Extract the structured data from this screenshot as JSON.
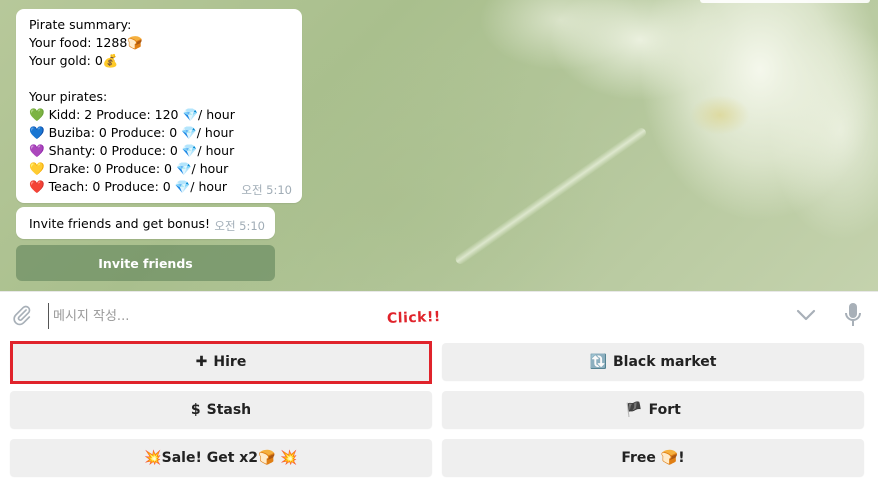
{
  "chat": {
    "summary": {
      "title": "Pirate summary:",
      "food_line": "Your food: 1288🍞",
      "gold_line": "Your gold: 0💰",
      "pirates_heading": "Your pirates:",
      "pirates": [
        {
          "emoji": "💚",
          "text": "Kidd: 2 Produce: 120 💎/ hour"
        },
        {
          "emoji": "💙",
          "text": "Buziba: 0 Produce: 0 💎/ hour"
        },
        {
          "emoji": "💜",
          "text": "Shanty: 0 Produce: 0 💎/ hour"
        },
        {
          "emoji": "💛",
          "text": "Drake: 0 Produce: 0 💎/ hour"
        },
        {
          "emoji": "❤️",
          "text": "Teach: 0 Produce: 0 💎/ hour"
        }
      ],
      "time": "오전 5:10"
    },
    "invite_message": {
      "text": "Invite friends and get bonus!",
      "time": "오전 5:10"
    },
    "invite_button_label": "Invite friends"
  },
  "composer": {
    "placeholder": "메시지 작성..."
  },
  "annotation": {
    "label": "Click!!",
    "color": "#e0232b"
  },
  "keyboard": {
    "hire": {
      "icon": "✚",
      "label": "Hire"
    },
    "black_market": {
      "icon": "🔃",
      "label": "Black market"
    },
    "stash": {
      "icon": "$",
      "label": "Stash"
    },
    "fort": {
      "icon": "🏴",
      "label": "Fort"
    },
    "sale": {
      "label": "💥Sale! Get x2🍞 💥"
    },
    "free": {
      "label": "Free 🍞!"
    }
  },
  "icons": {
    "attach": "paperclip-icon",
    "scroll": "chevron-down-icon",
    "mic": "microphone-icon"
  }
}
